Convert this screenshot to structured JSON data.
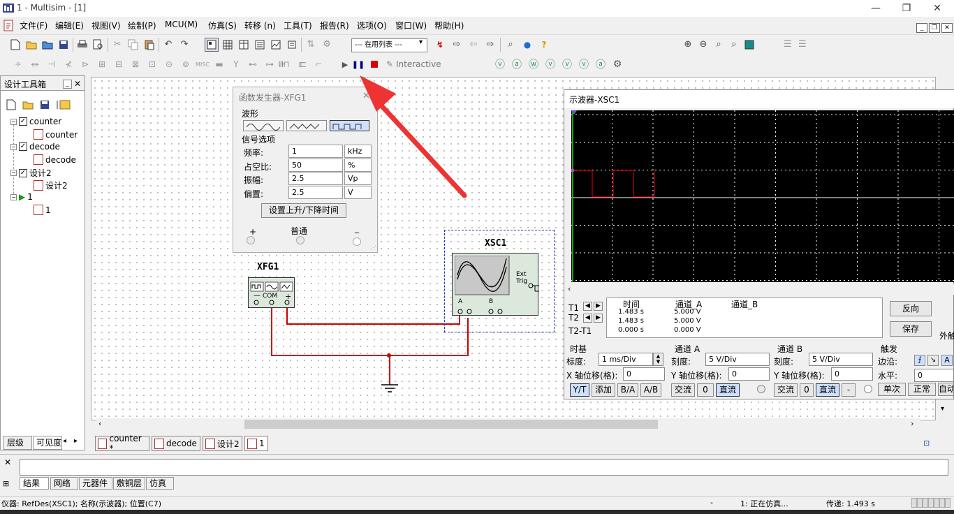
{
  "window": {
    "title": "1 - Multisim - [1]"
  },
  "menu": [
    "文件(F)",
    "编辑(E)",
    "视图(V)",
    "绘制(P)",
    "MCU(M)",
    "仿真(S)",
    "转移 (n)",
    "工具(T)",
    "报告(R)",
    "选项(O)",
    "窗口(W)",
    "帮助(H)"
  ],
  "toolbar": {
    "in_use_list": "--- 在用列表 ---",
    "interactive_label": "Interactive"
  },
  "design_toolbox": {
    "title": "设计工具箱",
    "tree": [
      {
        "label": "counter",
        "child": "counter"
      },
      {
        "label": "decode",
        "child": "decode"
      },
      {
        "label": "设计2",
        "child": "设计2"
      },
      {
        "label": "1",
        "child": "1"
      }
    ],
    "tabs": [
      "层级",
      "可见度"
    ]
  },
  "doc_tabs": [
    "counter *",
    "decode",
    "设计2",
    "1"
  ],
  "function_generator": {
    "title": "函数发生器-XFG1",
    "waveform_label": "波形",
    "signal_options_label": "信号选项",
    "rows": [
      {
        "label": "频率:",
        "value": "1",
        "unit": "kHz"
      },
      {
        "label": "占空比:",
        "value": "50",
        "unit": "%"
      },
      {
        "label": "振幅:",
        "value": "2.5",
        "unit": "Vp"
      },
      {
        "label": "偏置:",
        "value": "2.5",
        "unit": "V"
      }
    ],
    "rise_fall_button": "设置上升/下降时间",
    "plus": "+",
    "common": "普通",
    "minus": "_"
  },
  "schematic": {
    "xfg_name": "XFG1",
    "xfg_com": "COM",
    "xfg_minus": "—",
    "xfg_plus": "+",
    "xsc_name": "XSC1",
    "xsc_ext_trig": "Ext Trig",
    "xsc_a": "A",
    "xsc_b": "B"
  },
  "oscilloscope": {
    "title": "示波器-XSC1",
    "cursor_rows": [
      {
        "label": "T1",
        "time": "1.483 s",
        "channel_a": "5.000 V",
        "channel_b": ""
      },
      {
        "label": "T2",
        "time": "1.483 s",
        "channel_a": "5.000 V",
        "channel_b": ""
      },
      {
        "label": "T2-T1",
        "time": "0.000 s",
        "channel_a": "0.000 V",
        "channel_b": ""
      }
    ],
    "col_time": "时间",
    "col_a": "通道_A",
    "col_b": "通道_B",
    "reverse_button": "反向",
    "save_button": "保存",
    "ext_trigger": "外触",
    "timebase": {
      "title": "时基",
      "scale_label": "标度:",
      "scale": "1 ms/Div",
      "xpos_label": "X 轴位移(格):",
      "xpos": "0",
      "buttons": [
        "Y/T",
        "添加",
        "B/A",
        "A/B"
      ]
    },
    "channel_a": {
      "title": "通道 A",
      "scale_label": "刻度:",
      "scale": "5 V/Div",
      "ypos_label": "Y 轴位移(格):",
      "ypos": "0",
      "buttons": [
        "交流",
        "0",
        "直流"
      ]
    },
    "channel_b": {
      "title": "通道 B",
      "scale_label": "刻度:",
      "scale": "5 V/Div",
      "ypos_label": "Y 轴位移(格):",
      "ypos": "0",
      "buttons": [
        "交流",
        "0",
        "直流",
        "-"
      ]
    },
    "trigger": {
      "title": "触发",
      "edge_label": "边沿:",
      "level_label": "水平:",
      "level": "0",
      "edge_a": "A",
      "buttons": [
        "单次",
        "正常",
        "自动"
      ]
    }
  },
  "bottom_tabs": [
    "结果",
    "网络",
    "元器件",
    "敷铜层",
    "仿真"
  ],
  "statusbar": {
    "left": "仪器: RefDes(XSC1); 名称(示波器); 位置(C7)",
    "dash": "-",
    "sim_status": "1: 正在仿真...",
    "transfer": "传递: 1.493 s"
  },
  "colors": {
    "wire": "#cc0000",
    "arrow": "#ee3333",
    "trace": "#cc0000",
    "grid": "#ffffff"
  }
}
